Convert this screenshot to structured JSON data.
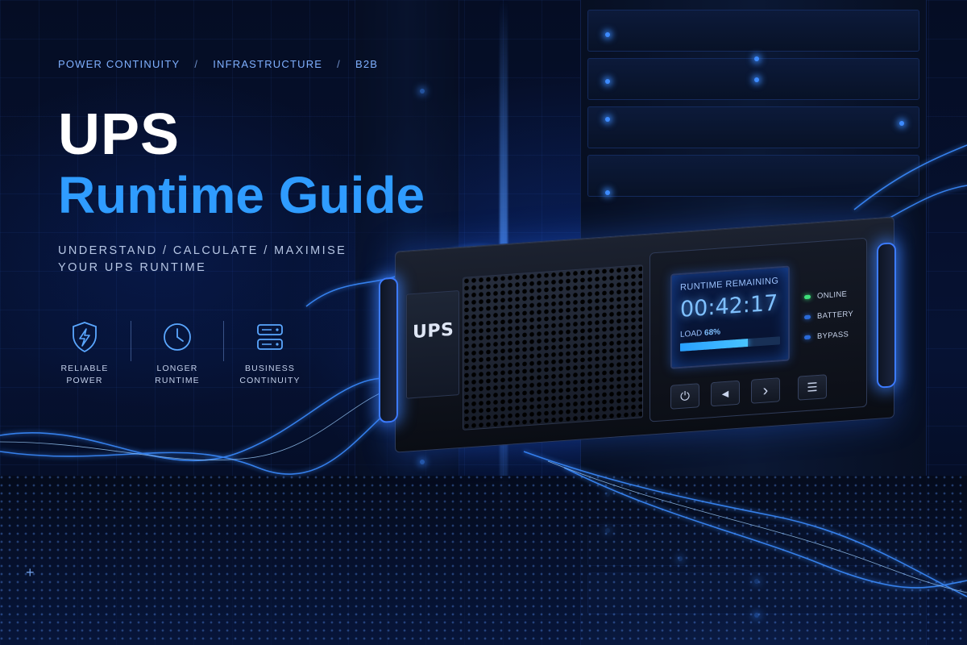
{
  "breadcrumb": {
    "items": [
      "POWER CONTINUITY",
      "INFRASTRUCTURE",
      "B2B"
    ],
    "separator": "/"
  },
  "hero": {
    "title_line1": "UPS",
    "title_line2": "Runtime Guide",
    "subtitle_line1": "UNDERSTAND / CALCULATE / MAXIMISE",
    "subtitle_line2": "YOUR UPS RUNTIME"
  },
  "features": [
    {
      "icon": "shield-bolt-icon",
      "line1": "RELIABLE",
      "line2": "POWER"
    },
    {
      "icon": "clock-icon",
      "line1": "LONGER",
      "line2": "RUNTIME"
    },
    {
      "icon": "server-stack-icon",
      "line1": "BUSINESS",
      "line2": "CONTINUITY"
    }
  ],
  "ups_unit": {
    "brand": "UPS",
    "display": {
      "title": "RUNTIME REMAINING",
      "time": "00:42:17",
      "load_label": "LOAD",
      "load_value": "68%",
      "load_fraction": 0.68
    },
    "status": [
      {
        "label": "ONLINE",
        "color": "#3ee07a"
      },
      {
        "label": "BATTERY",
        "color": "#2a6ad8"
      },
      {
        "label": "BYPASS",
        "color": "#2a6ad8"
      }
    ],
    "buttons": [
      {
        "icon": "power-icon",
        "glyph": "⏻"
      },
      {
        "icon": "chevron-left-icon",
        "glyph": "◀"
      },
      {
        "icon": "chevron-right-icon",
        "glyph": "›"
      },
      {
        "icon": "menu-icon",
        "glyph": "☰"
      }
    ]
  },
  "colors": {
    "accent": "#2f9cff",
    "background": "#050d24",
    "breadcrumb": "#7fb0ff"
  }
}
